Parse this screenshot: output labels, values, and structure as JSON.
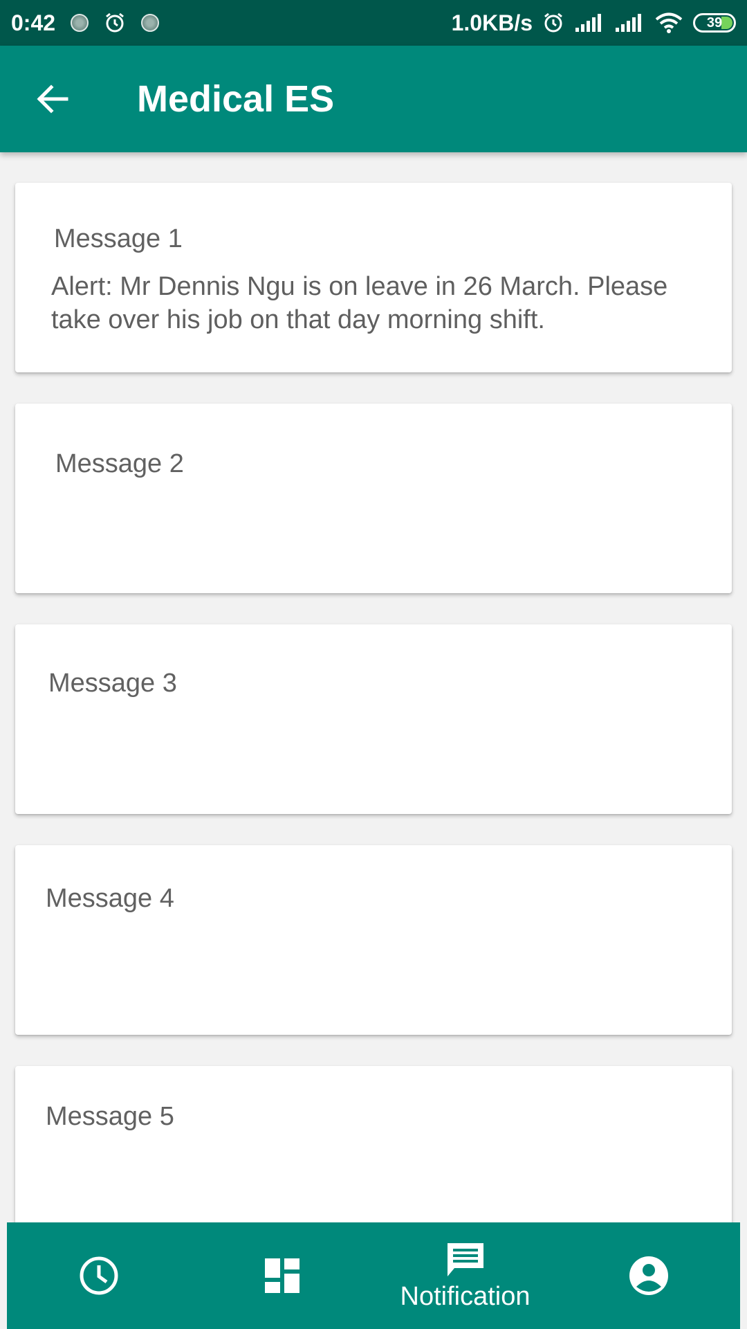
{
  "status_bar": {
    "time": "0:42",
    "network_speed": "1.0KB/s",
    "battery_level": "39"
  },
  "app_bar": {
    "title": "Medical ES",
    "back_icon": "arrow-back-icon"
  },
  "messages": [
    {
      "title": "Message 1",
      "body": "Alert: Mr Dennis Ngu is on leave in 26 March. Please take over  his job on that day morning shift."
    },
    {
      "title": "Message 2",
      "body": ""
    },
    {
      "title": "Message 3",
      "body": ""
    },
    {
      "title": "Message 4",
      "body": ""
    },
    {
      "title": "Message 5",
      "body": ""
    }
  ],
  "bottom_nav": {
    "items": [
      {
        "icon": "clock-icon",
        "label": ""
      },
      {
        "icon": "dashboard-icon",
        "label": ""
      },
      {
        "icon": "chat-icon",
        "label": "Notification"
      },
      {
        "icon": "account-circle-icon",
        "label": ""
      }
    ],
    "active_index": 2
  },
  "colors": {
    "status_bar": "#00574b",
    "primary": "#00897b",
    "background": "#f2f2f2",
    "card": "#ffffff",
    "text_secondary": "#616161"
  }
}
